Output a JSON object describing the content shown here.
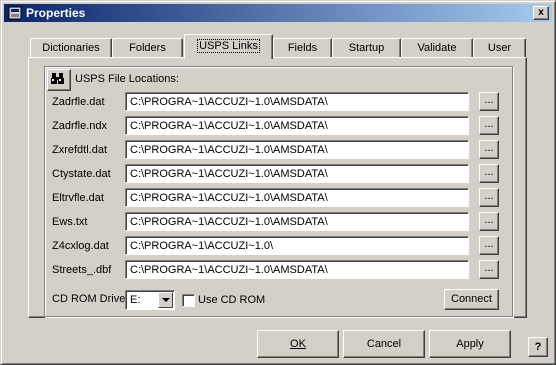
{
  "window": {
    "title": "Properties",
    "close_label": "x"
  },
  "tabs": [
    {
      "label": "Dictionaries",
      "active": false
    },
    {
      "label": "Folders",
      "active": false
    },
    {
      "label": "USPS Links",
      "active": true
    },
    {
      "label": "Fields",
      "active": false
    },
    {
      "label": "Startup",
      "active": false
    },
    {
      "label": "Validate",
      "active": false
    },
    {
      "label": "User",
      "active": false
    }
  ],
  "group": {
    "icon": "binoculars-icon",
    "title": "USPS File Locations:",
    "rows": [
      {
        "label": "Zadrfle.dat",
        "value": "C:\\PROGRA~1\\ACCUZI~1.0\\AMSDATA\\"
      },
      {
        "label": "Zadrfle.ndx",
        "value": "C:\\PROGRA~1\\ACCUZI~1.0\\AMSDATA\\"
      },
      {
        "label": "Zxrefdtl.dat",
        "value": "C:\\PROGRA~1\\ACCUZI~1.0\\AMSDATA\\"
      },
      {
        "label": "Ctystate.dat",
        "value": "C:\\PROGRA~1\\ACCUZI~1.0\\AMSDATA\\"
      },
      {
        "label": "Eltrvfle.dat",
        "value": "C:\\PROGRA~1\\ACCUZI~1.0\\AMSDATA\\"
      },
      {
        "label": "Ews.txt",
        "value": "C:\\PROGRA~1\\ACCUZI~1.0\\AMSDATA\\"
      },
      {
        "label": "Z4cxlog.dat",
        "value": "C:\\PROGRA~1\\ACCUZI~1.0\\"
      },
      {
        "label": "Streets_.dbf",
        "value": "C:\\PROGRA~1\\ACCUZI~1.0\\AMSDATA\\"
      }
    ],
    "browse_label": "..."
  },
  "cdrom": {
    "label": "CD ROM Drive:",
    "drive": "E:",
    "use_label": "Use CD ROM",
    "use_checked": false,
    "connect_label": "Connect"
  },
  "buttons": {
    "ok": "OK",
    "cancel": "Cancel",
    "apply": "Apply",
    "help": "?"
  }
}
